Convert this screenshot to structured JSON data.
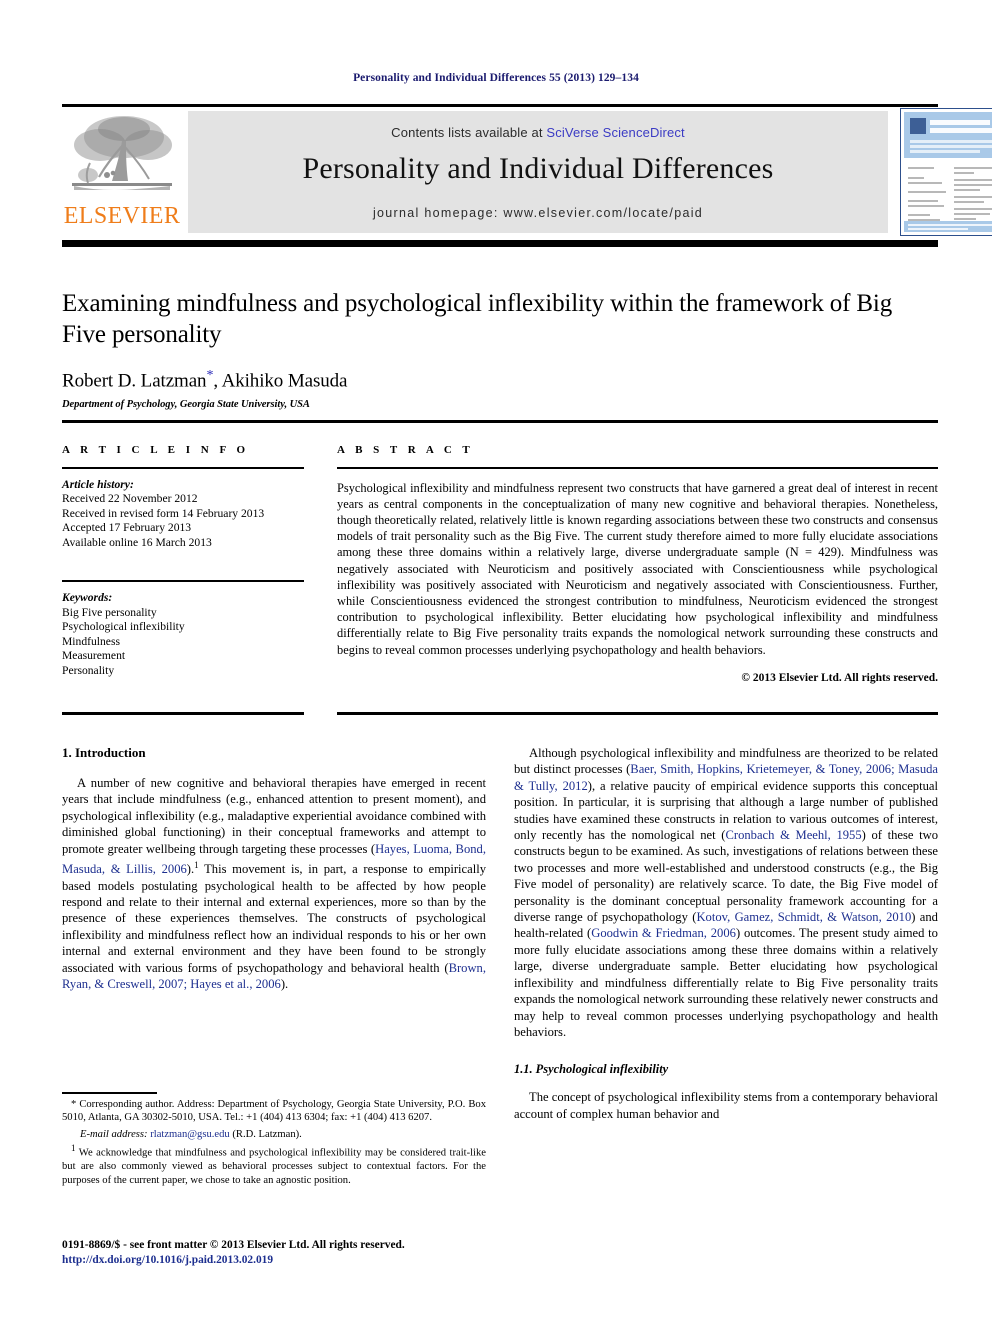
{
  "running_head": "Personality and Individual Differences 55 (2013) 129–134",
  "masthead": {
    "contents_prefix": "Contents lists available at ",
    "sciencedirect_link": "SciVerse ScienceDirect",
    "journal_title": "Personality and Individual Differences",
    "homepage": "journal homepage: www.elsevier.com/locate/paid",
    "publisher_wordmark": "ELSEVIER",
    "publisher_logo_icon": "elsevier-tree-icon",
    "cover_thumb_icon": "journal-cover-thumbnail",
    "cover_title_text": "PERSONALITY AND INDIVIDUAL DIFFERENCES",
    "band_color": "#e3e3e3",
    "link_color": "#3b3bc4",
    "wordmark_color": "#ef7d1a",
    "cover_accent_color": "#a9c9e8"
  },
  "title_block": {
    "title": "Examining mindfulness and psychological inflexibility within the framework of Big Five personality",
    "authors_part1": "Robert D. Latzman",
    "corresponding_marker": "*",
    "authors_part2": ", Akihiko Masuda",
    "affiliation": "Department of Psychology, Georgia State University, USA"
  },
  "article_info": {
    "heading": "A R T I C L E   I N F O",
    "history_label": "Article history:",
    "history": [
      "Received 22 November 2012",
      "Received in revised form 14 February 2013",
      "Accepted 17 February 2013",
      "Available online 16 March 2013"
    ],
    "keywords_label": "Keywords:",
    "keywords": [
      "Big Five personality",
      "Psychological inflexibility",
      "Mindfulness",
      "Measurement",
      "Personality"
    ]
  },
  "abstract": {
    "heading": "A B S T R A C T",
    "text": "Psychological inflexibility and mindfulness represent two constructs that have garnered a great deal of interest in recent years as central components in the conceptualization of many new cognitive and behavioral therapies. Nonetheless, though theoretically related, relatively little is known regarding associations between these two constructs and consensus models of trait personality such as the Big Five. The current study therefore aimed to more fully elucidate associations among these three domains within a relatively large, diverse undergraduate sample (N = 429). Mindfulness was negatively associated with Neuroticism and positively associated with Conscientiousness while psychological inflexibility was positively associated with Neuroticism and negatively associated with Conscientiousness. Further, while Conscientiousness evidenced the strongest contribution to mindfulness, Neuroticism evidenced the strongest contribution to psychological inflexibility. Better elucidating how psychological inflexibility and mindfulness differentially relate to Big Five personality traits expands the nomological network surrounding these constructs and begins to reveal common processes underlying psychopathology and health behaviors.",
    "copyright": "© 2013 Elsevier Ltd. All rights reserved."
  },
  "body": {
    "section1_heading": "1. Introduction",
    "para1_a": "A number of new cognitive and behavioral therapies have emerged in recent years that include mindfulness (e.g., enhanced attention to present moment), and psychological inflexibility (e.g., maladaptive experiential avoidance combined with diminished global functioning) in their conceptual frameworks and attempt to promote greater wellbeing through targeting these processes (",
    "para1_ref1": "Hayes, Luoma, Bond, Masuda, & Lillis, 2006",
    "para1_b": ").",
    "para1_footnote_marker": "1",
    "para1_c": " This movement is, in part, a response to empirically based models postulating psychological health to be affected by how people respond and relate to their internal and external experiences, more so than by the presence of these experiences themselves. The constructs of psychological inflexibility and mindfulness reflect how an individual responds to his or her own internal and external environment and they have been found to be strongly associated with various forms of psychopathology and behavioral health (",
    "para1_ref2": "Brown, Ryan, & Creswell, 2007; Hayes et al., 2006",
    "para1_d": ").",
    "para2_a": "Although psychological inflexibility and mindfulness are theorized to be related but distinct processes (",
    "para2_ref1": "Baer, Smith, Hopkins, Krietemeyer, & Toney, 2006; Masuda & Tully, 2012",
    "para2_b": "), a relative paucity of empirical evidence supports this conceptual position. In particular, it is surprising that although a large number of published studies have examined these constructs in relation to various outcomes of interest, only recently has the nomological net (",
    "para2_ref2": "Cronbach & Meehl, 1955",
    "para2_c": ") of these two constructs begun to be examined. As such, investigations of relations between these two processes and more well-established and understood constructs (e.g., the Big Five model of personality) are relatively scarce. To date, the Big Five model of personality is the dominant conceptual personality framework accounting for a diverse range of psychopathology (",
    "para2_ref3": "Kotov, Gamez, Schmidt, & Watson, 2010",
    "para2_d": ") and health-related (",
    "para2_ref4": "Goodwin & Friedman, 2006",
    "para2_e": ") outcomes. The present study aimed to more fully elucidate associations among these three domains within a relatively large, diverse undergraduate sample. Better elucidating how psychological inflexibility and mindfulness differentially relate to Big Five personality traits expands the nomological network surrounding these relatively newer constructs and may help to reveal common processes underlying psychopathology and health behaviors.",
    "section11_heading": "1.1. Psychological inflexibility",
    "para3": "The concept of psychological inflexibility stems from a contemporary behavioral account of complex human behavior and"
  },
  "footnotes": {
    "corresponding_marker": "*",
    "corresponding": " Corresponding author. Address: Department of Psychology, Georgia State University, P.O. Box 5010, Atlanta, GA 30302-5010, USA. Tel.: +1 (404) 413 6304; fax: +1 (404) 413 6207.",
    "email_label": "E-mail address:",
    "email": "rlatzman@gsu.edu",
    "email_suffix": " (R.D. Latzman).",
    "footnote1_marker": "1",
    "footnote1": " We acknowledge that mindfulness and psychological inflexibility may be considered trait-like but are also commonly viewed as behavioral processes subject to contextual factors. For the purposes of the current paper, we chose to take an agnostic position."
  },
  "colophon": {
    "line1": "0191-8869/$ - see front matter © 2013 Elsevier Ltd. All rights reserved.",
    "doi": "http://dx.doi.org/10.1016/j.paid.2013.02.019"
  }
}
